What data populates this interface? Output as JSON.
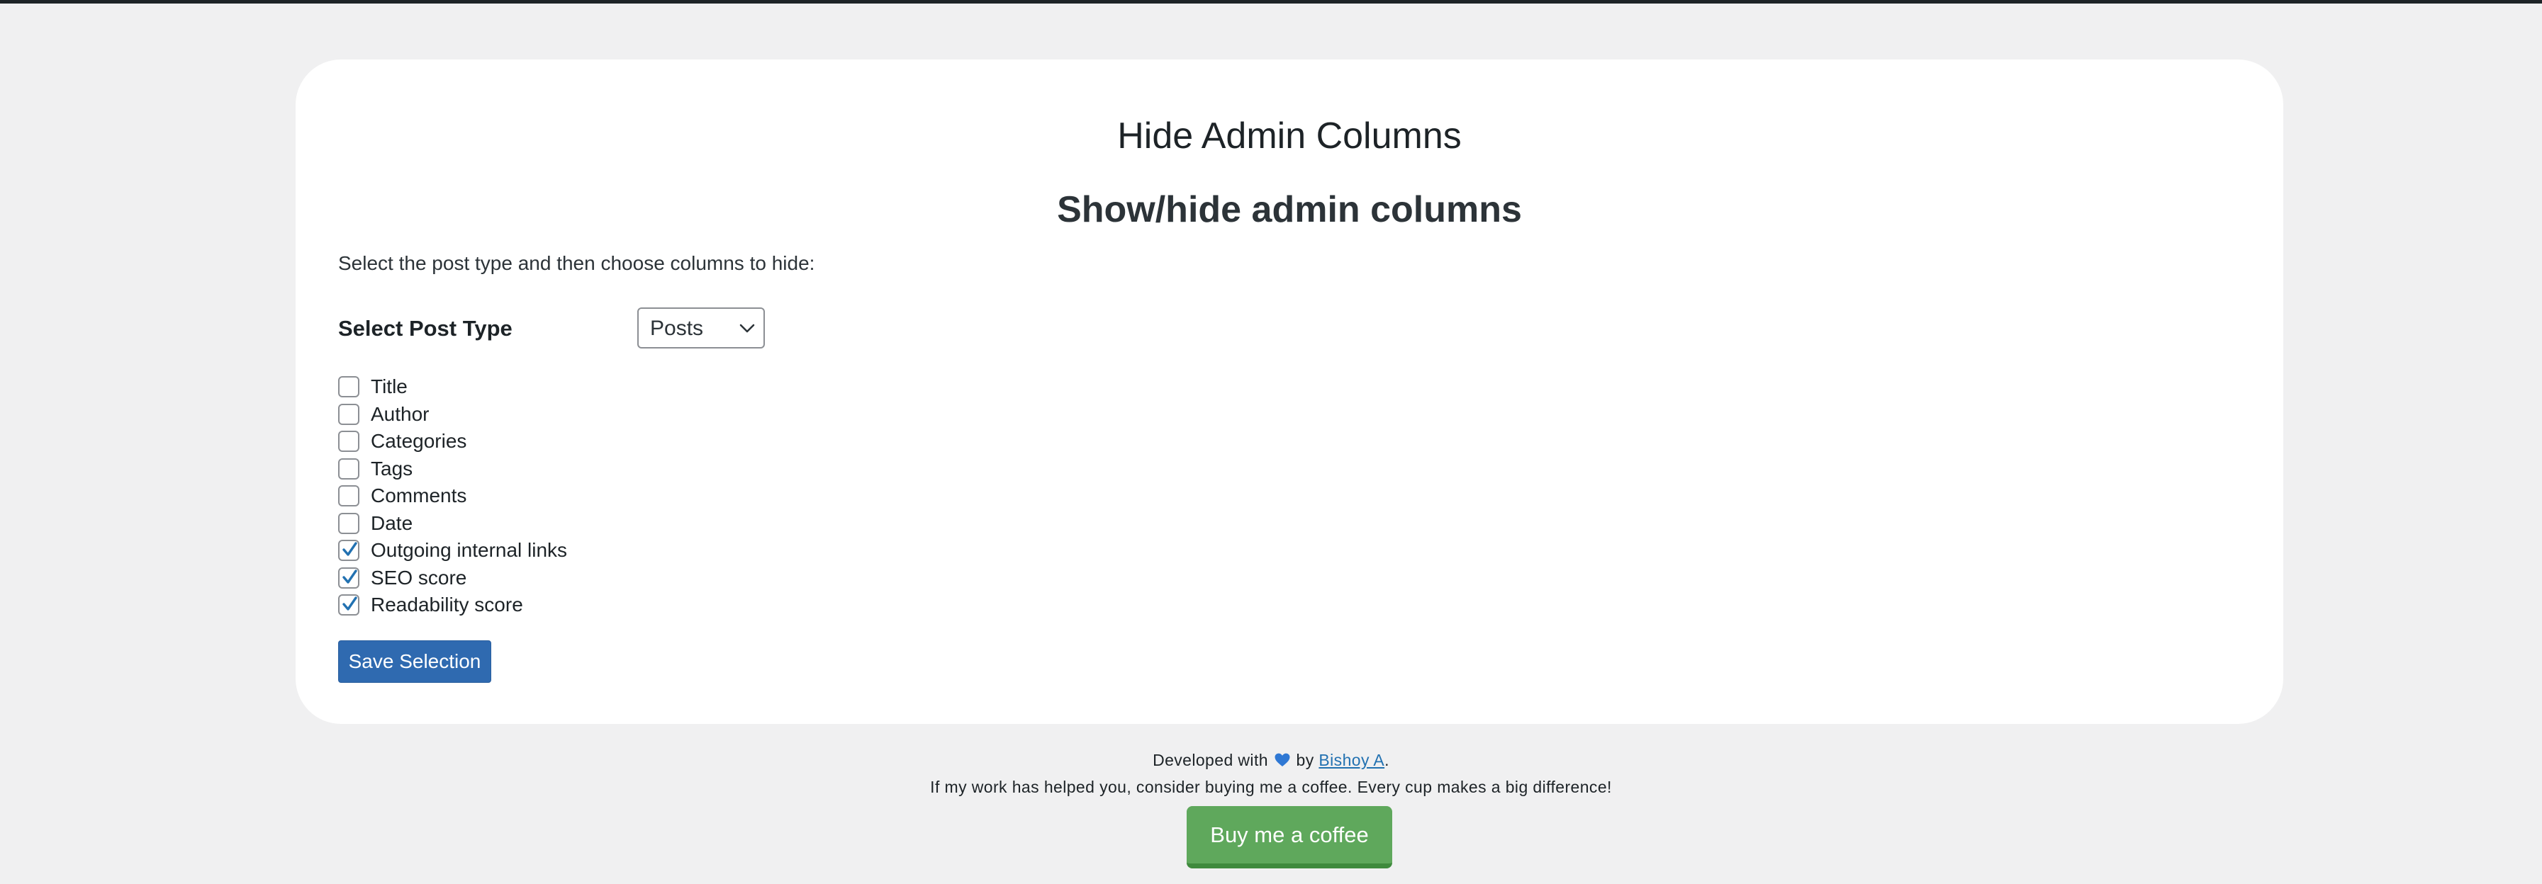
{
  "page": {
    "app_title": "Hide Admin Columns",
    "section_title": "Show/hide admin columns",
    "instructions": "Select the post type and then choose columns to hide:"
  },
  "post_type": {
    "label": "Select Post Type",
    "selected": "Posts"
  },
  "columns": [
    {
      "label": "Title",
      "checked": false
    },
    {
      "label": "Author",
      "checked": false
    },
    {
      "label": "Categories",
      "checked": false
    },
    {
      "label": "Tags",
      "checked": false
    },
    {
      "label": "Comments",
      "checked": false
    },
    {
      "label": "Date",
      "checked": false
    },
    {
      "label": "Outgoing internal links",
      "checked": true
    },
    {
      "label": "SEO score",
      "checked": true
    },
    {
      "label": "Readability score",
      "checked": true
    }
  ],
  "actions": {
    "save_label": "Save Selection"
  },
  "footer": {
    "developed_prefix": "Developed with",
    "heart_icon": "blue-heart-icon",
    "by_text": "by",
    "author_link": "Bishoy A",
    "period": ".",
    "support_text": "If my work has helped you, consider buying me a coffee. Every cup makes a big difference!",
    "coffee_button": "Buy me a coffee"
  },
  "colors": {
    "page_background": "#f0f0f1",
    "card_background": "#ffffff",
    "primary_button": "#2f6ab0",
    "checkmark": "#2271b1",
    "coffee_button": "#5fa85c",
    "link": "#2271b1",
    "heart": "#2f78d4"
  }
}
